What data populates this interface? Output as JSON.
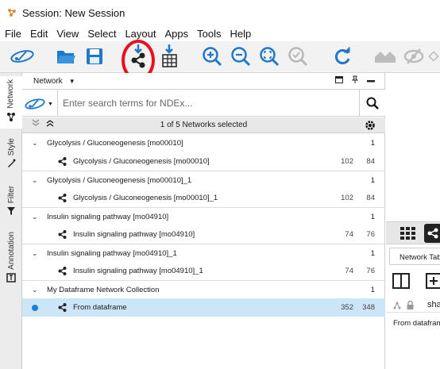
{
  "window": {
    "title": "Session: New Session"
  },
  "menubar": {
    "items": [
      "File",
      "Edit",
      "View",
      "Select",
      "Layout",
      "Apps",
      "Tools",
      "Help"
    ]
  },
  "colors": {
    "accent_blue": "#1f78c8",
    "annotation_red": "#e8121e",
    "selected_row": "#cde6f7"
  },
  "left_tabs": [
    "Network",
    "Style",
    "Filter",
    "Annotation"
  ],
  "network_panel": {
    "header": "Network",
    "search_placeholder": "Enter search terms for NDEx...",
    "selection_text": "1 of 5 Networks selected",
    "collections": [
      {
        "name": "Glycolysis / Gluconeogenesis [mo00010]",
        "count": "1",
        "network": {
          "name": "Glycolysis / Gluconeogenesis [mo00010]",
          "nodes": "102",
          "edges": "84"
        }
      },
      {
        "name": "Glycolysis / Gluconeogenesis [mo00010]_1",
        "count": "1",
        "network": {
          "name": "Glycolysis / Gluconeogenesis [mo00010]_1",
          "nodes": "102",
          "edges": "84"
        }
      },
      {
        "name": "Insulin signaling pathway [mo04910]",
        "count": "1",
        "network": {
          "name": "Insulin signaling pathway [mo04910]",
          "nodes": "74",
          "edges": "76"
        }
      },
      {
        "name": "Insulin signaling pathway [mo04910]_1",
        "count": "1",
        "network": {
          "name": "Insulin signaling pathway [mo04910]_1",
          "nodes": "74",
          "edges": "76"
        }
      },
      {
        "name": "My Dataframe Network Collection",
        "count": "1",
        "network": {
          "name": "From dataframe",
          "nodes": "352",
          "edges": "348",
          "selected": true
        }
      }
    ]
  },
  "table_panel": {
    "tab_label": "Network Table",
    "column_header": "sha",
    "row_value": "From datafram"
  },
  "toolbar_icons": [
    "open-session-icon",
    "save-session-icon",
    "import-network-icon",
    "import-table-icon",
    "zoom-in-icon",
    "zoom-out-icon",
    "zoom-fit-icon",
    "zoom-selected-icon",
    "refresh-icon",
    "show-all-icon",
    "hide-icon"
  ]
}
